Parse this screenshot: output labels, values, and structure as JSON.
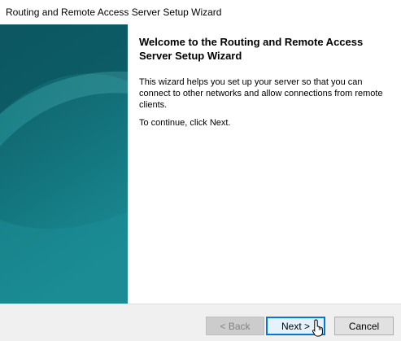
{
  "window": {
    "title": "Routing and Remote Access Server Setup Wizard"
  },
  "content": {
    "heading": "Welcome to the Routing and Remote Access Server Setup Wizard",
    "paragraph1": "This wizard helps you set up your server so that you can connect to other networks and allow connections from remote clients.",
    "paragraph2": "To continue, click Next."
  },
  "buttons": {
    "back": "< Back",
    "next": "Next >",
    "cancel": "Cancel"
  },
  "colors": {
    "banner_dark": "#0b5761",
    "banner_light": "#1f8f97",
    "focus_border": "#0078d7"
  },
  "icons": {
    "cursor": "hand-pointer-icon"
  }
}
